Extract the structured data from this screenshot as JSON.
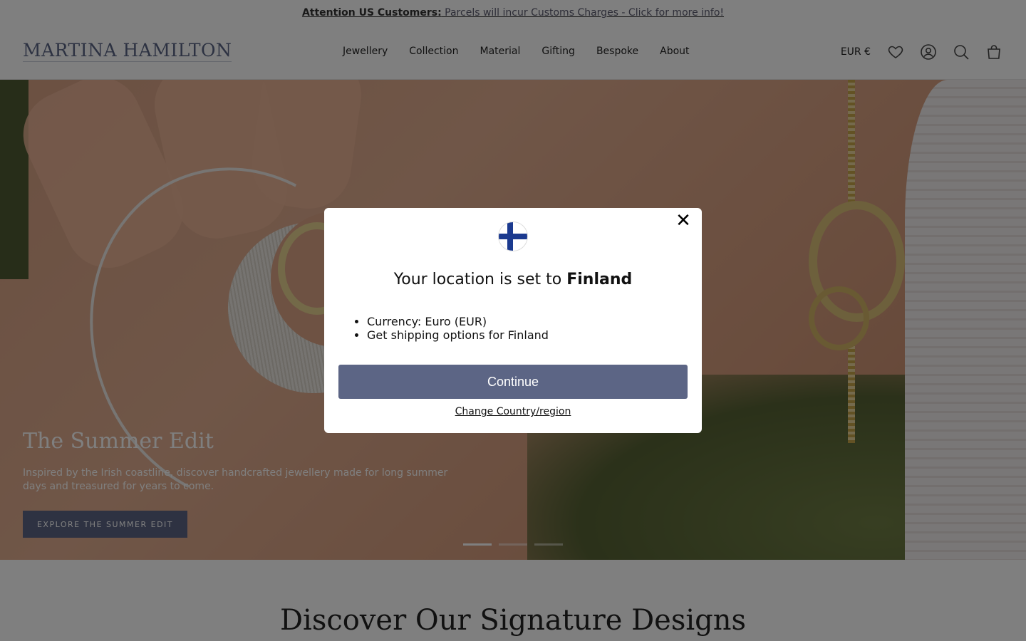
{
  "announcement": {
    "bold": "Attention US Customers:",
    "text": " Parcels will incur Customs Charges - Click for more info!"
  },
  "header": {
    "logo": "MARTINA HAMILTON",
    "nav": [
      "Jewellery",
      "Collection",
      "Material",
      "Gifting",
      "Bespoke",
      "About"
    ],
    "currency": "EUR €",
    "icons": [
      "wishlist-heart-icon",
      "account-icon",
      "search-icon",
      "bag-icon"
    ]
  },
  "hero": {
    "title": "The Summer Edit",
    "text": "Inspired by the Irish coastline, discover handcrafted jewellery made for long summer days and treasured for years to come.",
    "button": "EXPLORE THE SUMMER EDIT",
    "slides": 3,
    "active_slide": 1
  },
  "section": {
    "title": "Discover Our Signature Designs"
  },
  "modal": {
    "flag_icon": "finland-flag-icon",
    "title_prefix": "Your location is set to ",
    "title_country": "Finland",
    "items": [
      "Currency: Euro (EUR)",
      "Get shipping options for Finland"
    ],
    "continue_label": "Continue",
    "change_label": "Change Country/region",
    "accent_color": "#5c6585"
  }
}
